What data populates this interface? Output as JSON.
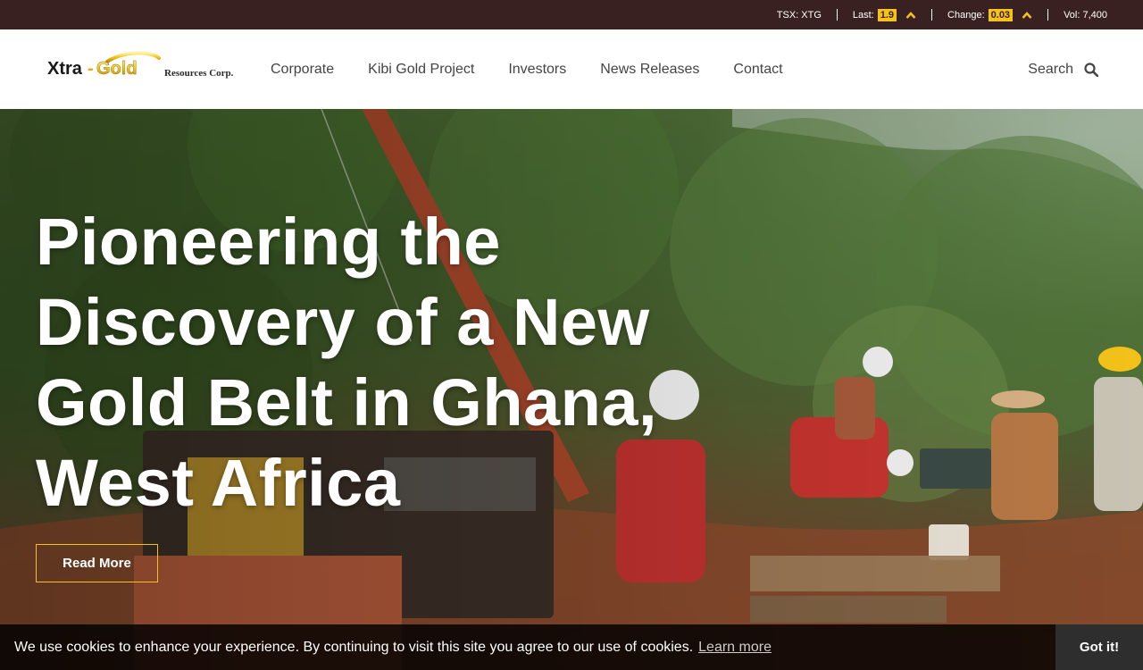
{
  "ticker": {
    "symbol": "TSX: XTG",
    "last_label": "Last:",
    "last_value": "1.9",
    "change_label": "Change:",
    "change_value": "0.03",
    "volume": "Vol: 7,400",
    "trend_icon": "chevron-up-icon"
  },
  "logo": {
    "name_part1": "Xtra",
    "name_part2": "Gold",
    "suffix": "Resources Corp."
  },
  "nav": {
    "items": [
      {
        "label": "Corporate"
      },
      {
        "label": "Kibi Gold Project"
      },
      {
        "label": "Investors"
      },
      {
        "label": "News Releases"
      },
      {
        "label": "Contact"
      }
    ],
    "search_label": "Search",
    "search_icon": "search-icon"
  },
  "hero": {
    "title": "Pioneering the Discovery of a New Gold Belt in Ghana, West Africa",
    "button_label": "Read More"
  },
  "cookie": {
    "message": "We use cookies to enhance your experience. By continuing to visit this site you agree to our use of cookies.",
    "link_label": "Learn more",
    "accept_label": "Got it!"
  },
  "colors": {
    "ticker_bg": "#3a2121",
    "accent": "#f5c21b",
    "nav_text": "#444444"
  }
}
